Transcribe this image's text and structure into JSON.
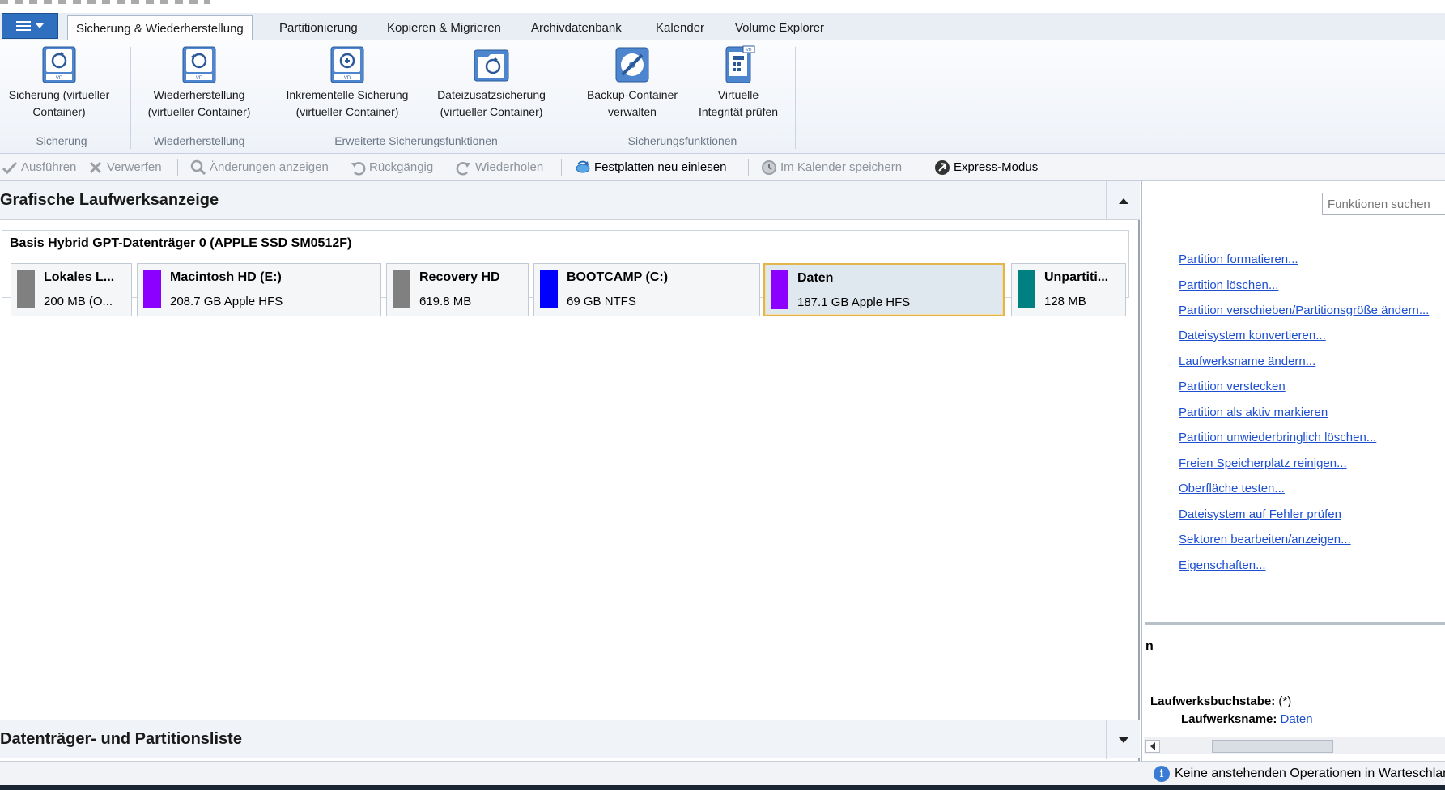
{
  "tabs": [
    {
      "label": "Sicherung & Wiederherstellung",
      "active": true
    },
    {
      "label": "Partitionierung"
    },
    {
      "label": "Kopieren & Migrieren"
    },
    {
      "label": "Archivdatenbank"
    },
    {
      "label": "Kalender"
    },
    {
      "label": "Volume Explorer"
    }
  ],
  "ribbon": {
    "buttons": [
      {
        "line1": "Sicherung (virtueller",
        "line2": "Container)"
      },
      {
        "line1": "Wiederherstellung",
        "line2": "(virtueller Container)"
      },
      {
        "line1": "Inkrementelle Sicherung",
        "line2": "(virtueller Container)"
      },
      {
        "line1": "Dateizusatzsicherung",
        "line2": "(virtueller Container)"
      },
      {
        "line1": "Backup-Container",
        "line2": "verwalten"
      },
      {
        "line1": "Virtuelle",
        "line2": "Integrität prüfen"
      }
    ],
    "groups": [
      "Sicherung",
      "Wiederherstellung",
      "Erweiterte Sicherungsfunktionen",
      "Sicherungsfunktionen"
    ],
    "icon_text": "VD"
  },
  "toolbar": {
    "apply": "Ausführen",
    "discard": "Verwerfen",
    "show_changes": "Änderungen anzeigen",
    "undo": "Rückgängig",
    "redo": "Wiederholen",
    "rescan": "Festplatten neu einlesen",
    "save_calendar": "Im Kalender speichern",
    "express": "Express-Modus"
  },
  "graphic_view": {
    "title": "Grafische Laufwerksanzeige",
    "disk_title": "Basis Hybrid GPT-Datenträger 0 (APPLE SSD SM0512F)",
    "partitions": [
      {
        "name": "Lokales L...",
        "info": "200 MB  (O...",
        "color": "#808080"
      },
      {
        "name": "Macintosh HD (E:)",
        "info": "208.7 GB Apple HFS",
        "color": "#8b00ff"
      },
      {
        "name": "Recovery HD",
        "info": "619.8 MB",
        "color": "#808080"
      },
      {
        "name": "BOOTCAMP (C:)",
        "info": "69 GB NTFS",
        "color": "#0000ff"
      },
      {
        "name": "Daten",
        "info": "187.1 GB Apple HFS",
        "color": "#8b00ff",
        "selected": true
      },
      {
        "name": "Unpartiti...",
        "info": "128 MB",
        "color": "#008080"
      }
    ]
  },
  "partition_list": {
    "title": "Datenträger- und Partitionsliste"
  },
  "functions": {
    "search_placeholder": "Funktionen suchen",
    "links": [
      "Partition formatieren...",
      "Partition löschen...",
      "Partition verschieben/Partitionsgröße ändern...",
      "Dateisystem konvertieren...",
      "Laufwerksname ändern...",
      "Partition verstecken",
      "Partition als aktiv markieren",
      "Partition unwiederbringlich löschen...",
      "Freien Speicherplatz reinigen...",
      "Oberfläche testen...",
      "Dateisystem auf Fehler prüfen",
      "Sektoren bearbeiten/anzeigen...",
      "Eigenschaften..."
    ]
  },
  "properties": {
    "header": "n",
    "drive_letter_label": "Laufwerksbuchstabe:",
    "drive_letter_value": "(*)",
    "drive_name_label": "Laufwerksname:",
    "drive_name_value": "Daten"
  },
  "status": {
    "text": "Keine anstehenden Operationen in Warteschlange"
  }
}
